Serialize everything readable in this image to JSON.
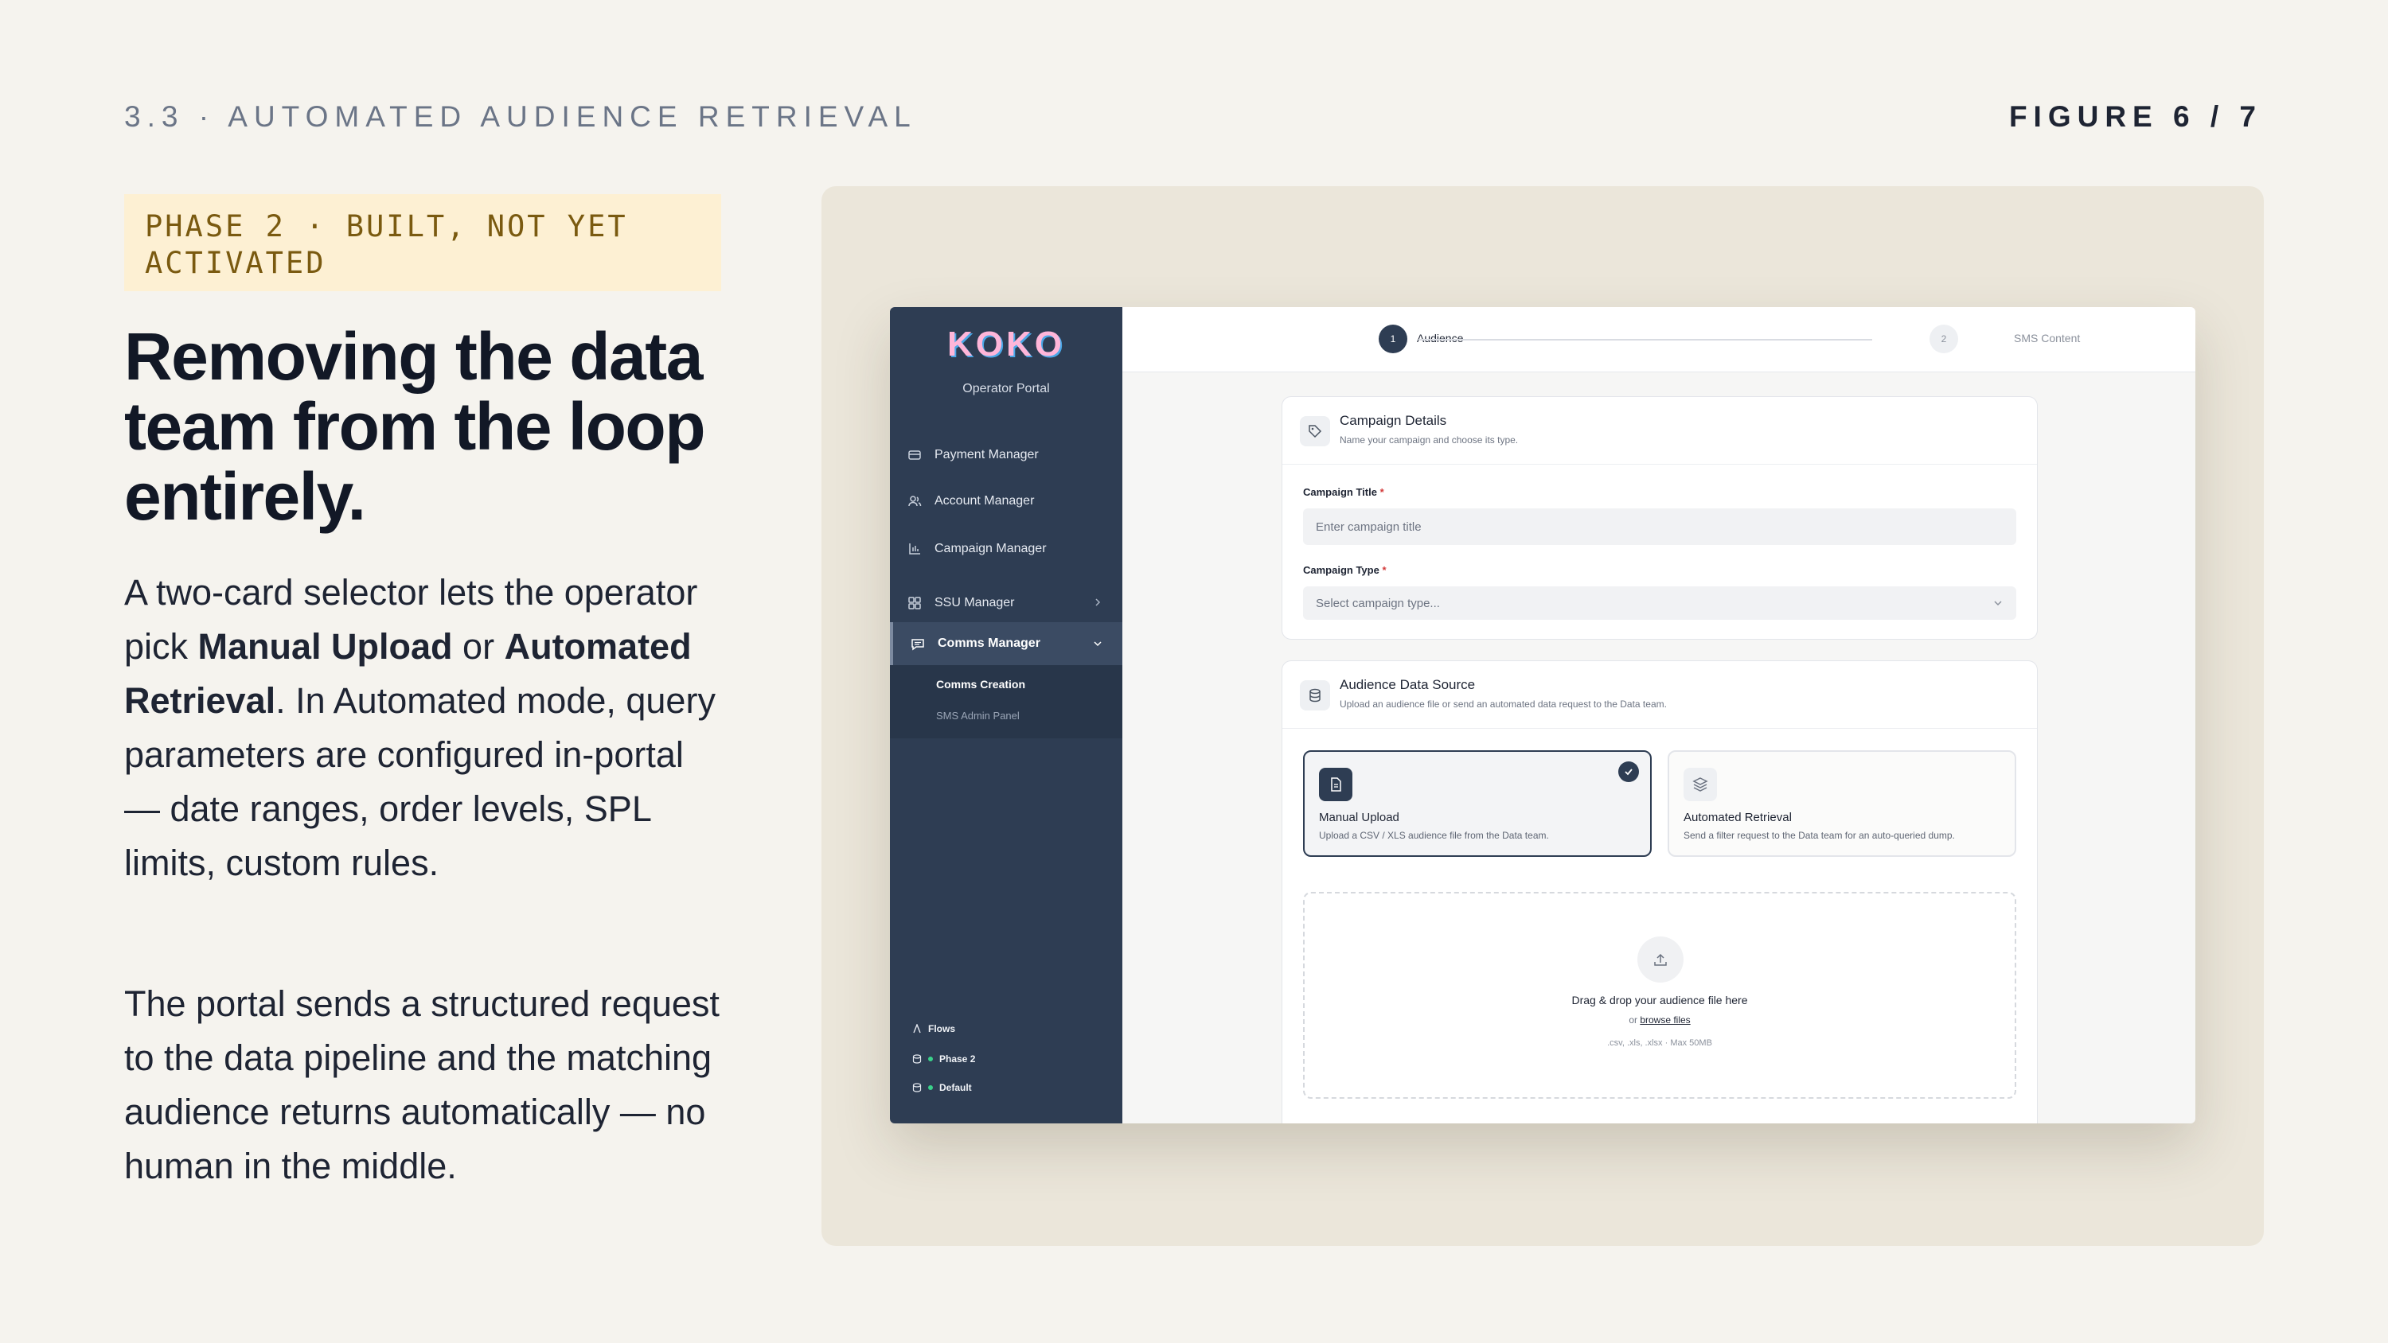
{
  "header": {
    "section_label": "3.3 · AUTOMATED AUDIENCE RETRIEVAL",
    "figure_label": "FIGURE 6 / 7"
  },
  "left": {
    "phase_badge": "PHASE 2 · BUILT, NOT YET ACTIVATED",
    "headline": "Removing the data team from the loop entirely.",
    "p1": {
      "t1": "A two-card selector lets the operator pick ",
      "b1": "Manual Upload",
      "t2": " or ",
      "b2": "Automated Retrieval",
      "t3": ". In Automated mode, query parameters are configured in-portal — date ranges, order levels, SPL limits, custom rules."
    },
    "p2": "The portal sends a structured request to the data pipeline and the matching audience returns automatically — no human in the middle."
  },
  "app": {
    "logo": "KOKO",
    "portal_label": "Operator Portal",
    "nav": {
      "payment": "Payment Manager",
      "account": "Account Manager",
      "campaign": "Campaign Manager",
      "ssu": "SSU Manager",
      "comms": "Comms Manager"
    },
    "subnav": {
      "comms_creation": "Comms Creation",
      "sms_admin": "SMS Admin Panel"
    },
    "footer": {
      "flows": "Flows",
      "phase": "Phase 2",
      "default": "Default"
    },
    "stepper": {
      "step1_num": "1",
      "step1_label": "Audience",
      "step2_num": "2",
      "step2_label": "SMS Content"
    },
    "campaign_card": {
      "title": "Campaign Details",
      "subtitle": "Name your campaign and choose its type.",
      "title_label": "Campaign Title",
      "title_placeholder": "Enter campaign title",
      "type_label": "Campaign Type",
      "type_placeholder": "Select campaign type...",
      "required_mark": "*"
    },
    "audience_card": {
      "title": "Audience Data Source",
      "subtitle": "Upload an audience file or send an automated data request to the Data team.",
      "manual_title": "Manual Upload",
      "manual_desc": "Upload a CSV / XLS audience file from the Data team.",
      "auto_title": "Automated Retrieval",
      "auto_desc": "Send a filter request to the Data team for an auto-queried dump.",
      "dropzone_title": "Drag & drop your audience file here",
      "dropzone_or": "or ",
      "dropzone_browse": "browse files",
      "dropzone_hint": ".csv, .xls, .xlsx · Max 50MB"
    }
  },
  "colors": {
    "background": "#f5f3ee",
    "panel": "#ebe6da",
    "sidebar": "#2e3d53",
    "badge_bg": "#fdf0d3",
    "badge_text": "#7a5a10",
    "accent_dark": "#2e3d53"
  }
}
